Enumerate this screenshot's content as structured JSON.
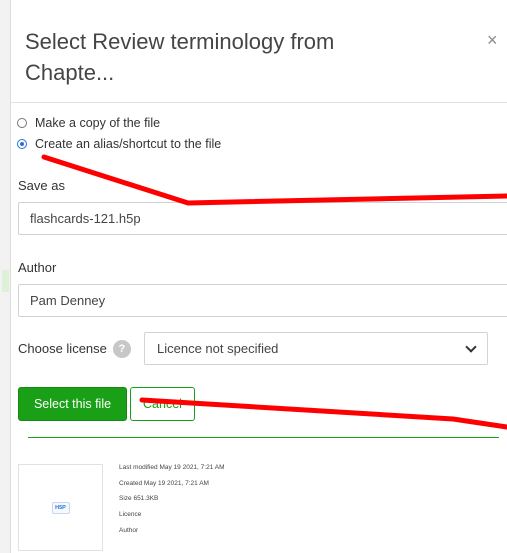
{
  "dialog": {
    "title": "Select Review terminology from Chapte...",
    "close_glyph": "×"
  },
  "link_options": [
    {
      "label": "Make a copy of the file",
      "checked": false
    },
    {
      "label": "Create an alias/shortcut to the file",
      "checked": true
    }
  ],
  "save_as": {
    "label": "Save as",
    "value": "flashcards-121.h5p"
  },
  "author": {
    "label": "Author",
    "value": "Pam Denney"
  },
  "license": {
    "label": "Choose license",
    "help_glyph": "?",
    "selected": "Licence not specified"
  },
  "buttons": {
    "select_label": "Select this file",
    "cancel_label": "Cancel"
  },
  "file_info": {
    "icon_text": "H5P",
    "last_modified": "Last modified  May 19 2021, 7:21 AM",
    "created": "Created  May 19 2021, 7:21 AM",
    "size": "Size  651.3KB",
    "licence": "Licence",
    "author": "Author"
  },
  "colors": {
    "primary_green": "#19a017",
    "annotation_red": "#ff0000",
    "radio_blue": "#2b6fd6"
  }
}
